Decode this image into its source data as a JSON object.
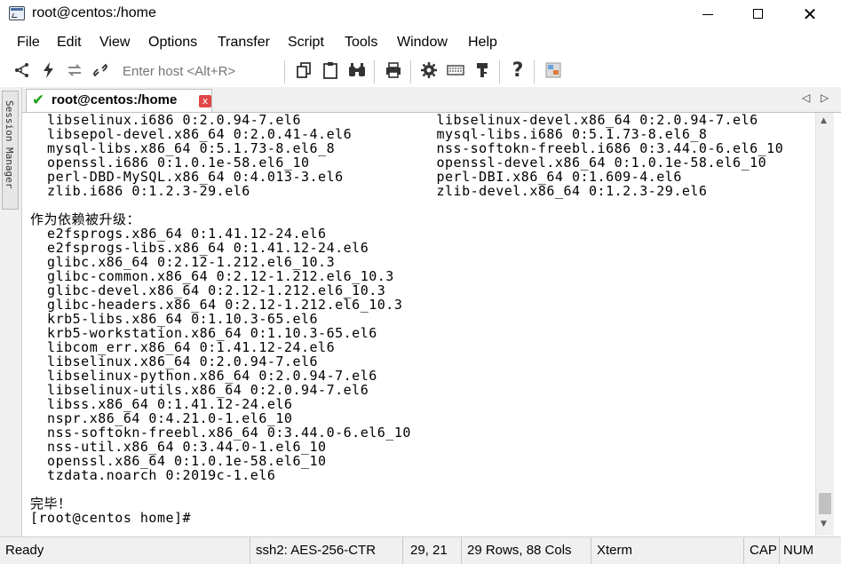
{
  "window": {
    "title": "root@centos:/home",
    "minimize_glyph": "",
    "maximize_glyph": "",
    "close_glyph": "✕"
  },
  "menu": [
    "File",
    "Edit",
    "View",
    "Options",
    "Transfer",
    "Script",
    "Tools",
    "Window",
    "Help"
  ],
  "toolbar": {
    "host_placeholder": "Enter host <Alt+R>",
    "icons": [
      "connect-icon",
      "quick-connect-icon",
      "reconnect-icon",
      "disconnect-icon",
      "copy-icon",
      "paste-icon",
      "find-icon",
      "print-icon",
      "settings-icon",
      "keymap-icon",
      "key-icon",
      "help-icon",
      "sftp-icon"
    ]
  },
  "session_manager": {
    "label": "Session Manager"
  },
  "tab": {
    "label": "root@centos:/home",
    "close_glyph": "x"
  },
  "terminal": {
    "lines": [
      "  libselinux.i686 0:2.0.94-7.el6                libselinux-devel.x86_64 0:2.0.94-7.el6",
      "  libsepol-devel.x86_64 0:2.0.41-4.el6          mysql-libs.i686 0:5.1.73-8.el6_8",
      "  mysql-libs.x86_64 0:5.1.73-8.el6_8            nss-softokn-freebl.i686 0:3.44.0-6.el6_10",
      "  openssl.i686 0:1.0.1e-58.el6_10               openssl-devel.x86_64 0:1.0.1e-58.el6_10",
      "  perl-DBD-MySQL.x86_64 0:4.013-3.el6           perl-DBI.x86_64 0:1.609-4.el6",
      "  zlib.i686 0:1.2.3-29.el6                      zlib-devel.x86_64 0:1.2.3-29.el6",
      "",
      "作为依赖被升级：",
      "  e2fsprogs.x86_64 0:1.41.12-24.el6",
      "  e2fsprogs-libs.x86_64 0:1.41.12-24.el6",
      "  glibc.x86_64 0:2.12-1.212.el6_10.3",
      "  glibc-common.x86_64 0:2.12-1.212.el6_10.3",
      "  glibc-devel.x86_64 0:2.12-1.212.el6_10.3",
      "  glibc-headers.x86_64 0:2.12-1.212.el6_10.3",
      "  krb5-libs.x86_64 0:1.10.3-65.el6",
      "  krb5-workstation.x86_64 0:1.10.3-65.el6",
      "  libcom_err.x86_64 0:1.41.12-24.el6",
      "  libselinux.x86_64 0:2.0.94-7.el6",
      "  libselinux-python.x86_64 0:2.0.94-7.el6",
      "  libselinux-utils.x86_64 0:2.0.94-7.el6",
      "  libss.x86_64 0:1.41.12-24.el6",
      "  nspr.x86_64 0:4.21.0-1.el6_10",
      "  nss-softokn-freebl.x86_64 0:3.44.0-6.el6_10",
      "  nss-util.x86_64 0:3.44.0-1.el6_10",
      "  openssl.x86_64 0:1.0.1e-58.el6_10",
      "  tzdata.noarch 0:2019c-1.el6",
      "",
      "完毕！",
      "[root@centos home]# "
    ]
  },
  "status": {
    "ready": "Ready",
    "protocol": "ssh2: AES-256-CTR",
    "cursor_pos": "29,  21",
    "size": "29 Rows, 88 Cols",
    "terminal_type": "Xterm",
    "caps": "CAP",
    "num": "NUM"
  }
}
